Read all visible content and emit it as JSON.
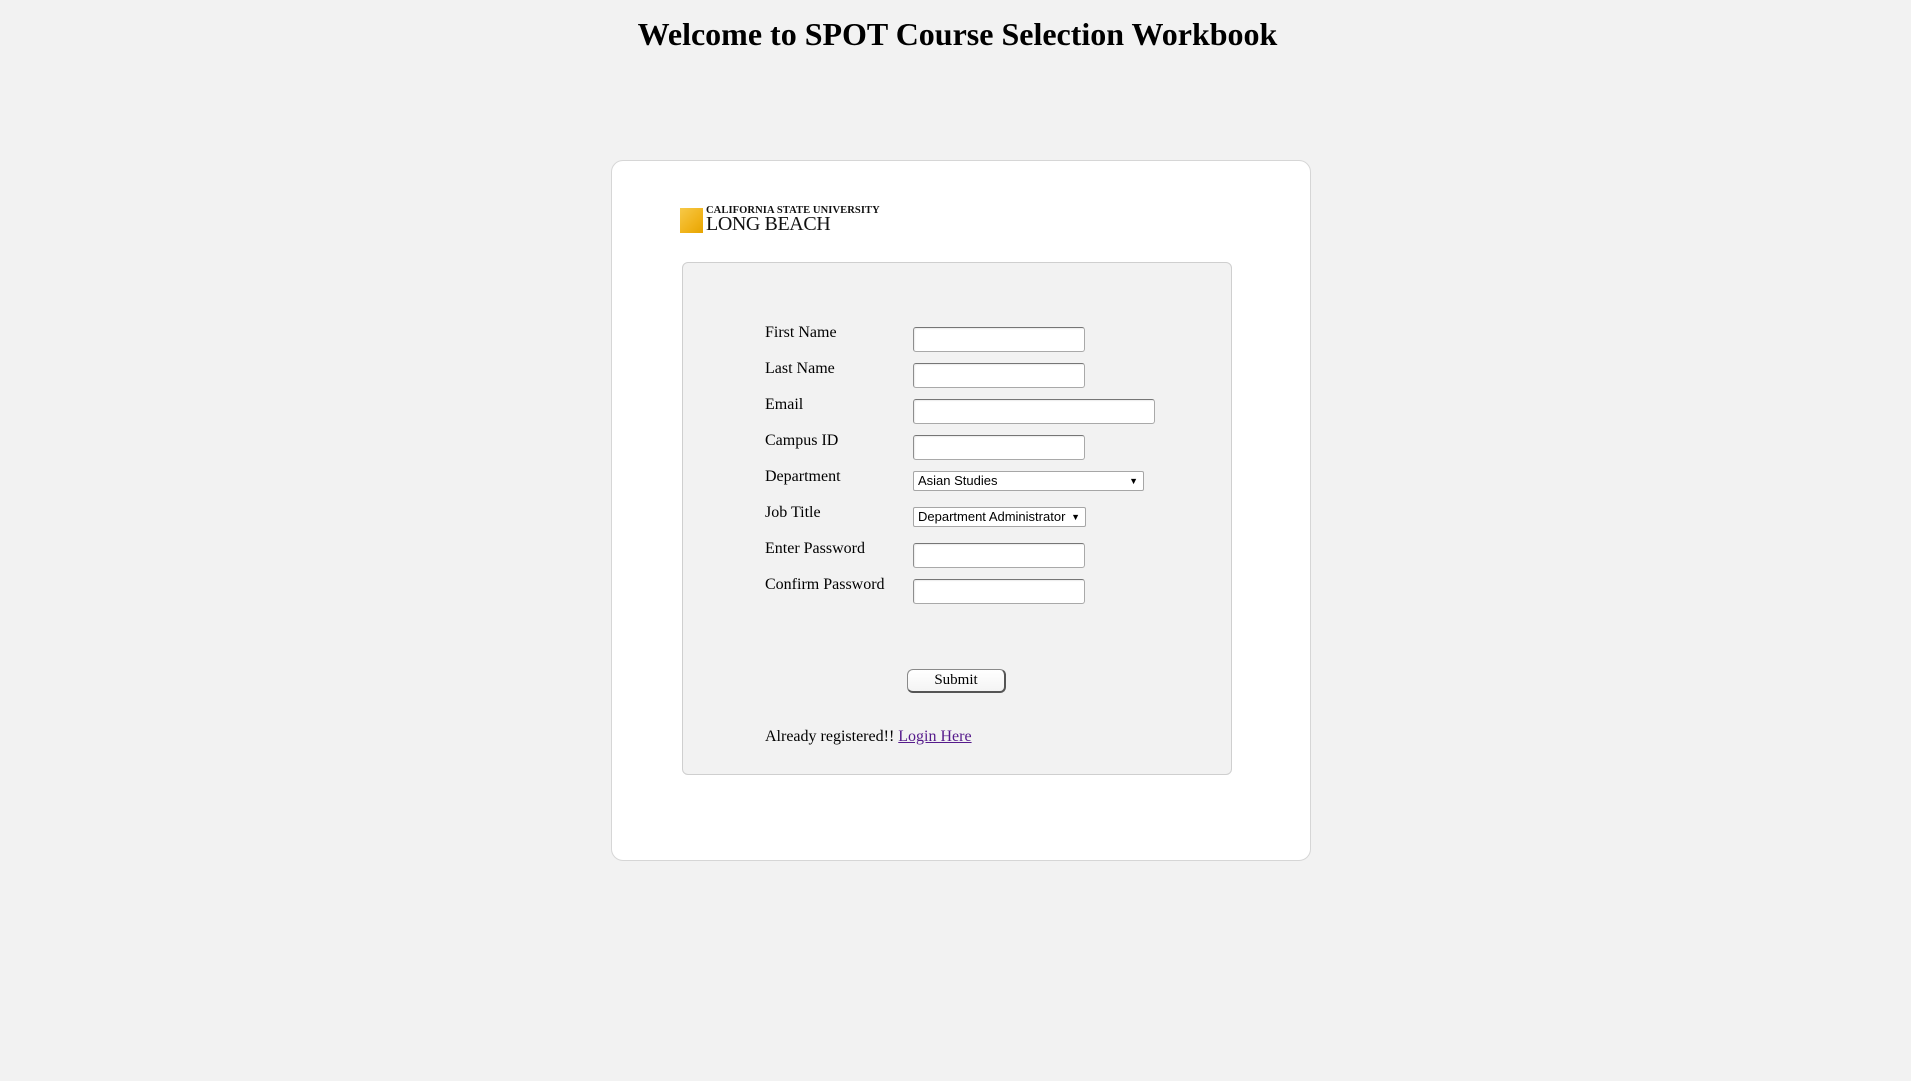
{
  "page": {
    "title": "Welcome to SPOT Course Selection Workbook"
  },
  "logo": {
    "line1": "CALIFORNIA STATE UNIVERSITY",
    "line2": "LONG BEACH",
    "accent_color": "#f0b31a"
  },
  "form": {
    "fields": {
      "first_name": {
        "label": "First Name",
        "value": "",
        "placeholder": ""
      },
      "last_name": {
        "label": "Last Name",
        "value": "",
        "placeholder": ""
      },
      "email": {
        "label": "Email",
        "value": "",
        "placeholder": ""
      },
      "campus_id": {
        "label": "Campus ID",
        "value": "",
        "placeholder": ""
      },
      "department": {
        "label": "Department",
        "selected": "Asian Studies"
      },
      "job_title": {
        "label": "Job Title",
        "selected": "Department Administrator"
      },
      "password": {
        "label": "Enter Password",
        "value": ""
      },
      "confirm_password": {
        "label": "Confirm Password",
        "value": ""
      }
    },
    "submit_label": "Submit",
    "already_registered_text": "Already registered!!",
    "login_link_label": "Login Here",
    "link_color": "#551a8b"
  },
  "icons": {
    "dropdown": "chevron-down-icon"
  }
}
